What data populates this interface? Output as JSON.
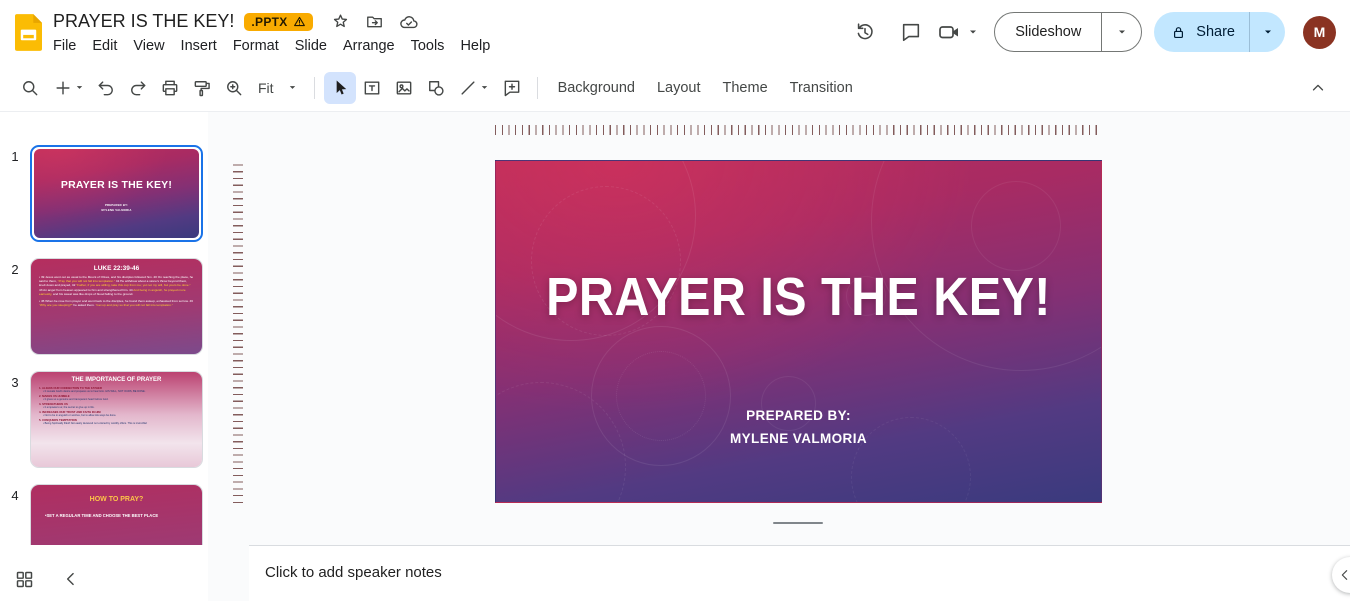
{
  "header": {
    "doc_title": "PRAYER IS THE KEY!",
    "file_badge": ".PPTX",
    "menus": [
      "File",
      "Edit",
      "View",
      "Insert",
      "Format",
      "Slide",
      "Arrange",
      "Tools",
      "Help"
    ],
    "slideshow_label": "Slideshow",
    "share_label": "Share",
    "avatar_initial": "M"
  },
  "toolbar": {
    "zoom_fit_label": "Fit",
    "background_label": "Background",
    "layout_label": "Layout",
    "theme_label": "Theme",
    "transition_label": "Transition"
  },
  "filmstrip": {
    "slides": [
      {
        "number": "1",
        "title": "PRAYER IS THE KEY!",
        "sub1": "PREPARED BY:",
        "sub2": "MYLENE VALMORIA"
      },
      {
        "number": "2",
        "title": "LUKE 22:39-46",
        "body1": [
          {
            "t": "• 39 Jesus went out as usual to the Mount of Olives, and his disciples followed him. 40 On reaching the place, he said to them, ",
            "hl": false
          },
          {
            "t": "“Pray that you will not fall into temptation.”",
            "hl": true
          },
          {
            "t": " 41 He withdrew about a stone’s throw beyond them, knelt down and prayed, 42 ",
            "hl": false
          },
          {
            "t": "“Father, if you are willing, take this cup from me; yet not my will, but yours be done.”",
            "hl": true
          },
          {
            "t": " 43 An angel from heaven appeared to him and strengthened him. 44 ",
            "hl": false
          },
          {
            "t": "And being in anguish, he prayed more earnestly,",
            "hl": true
          },
          {
            "t": " and his sweat was like drops of blood falling to the ground.",
            "hl": false
          }
        ],
        "body2": [
          {
            "t": "• 45 When he rose from prayer and went back to the disciples, he found them asleep, exhausted from sorrow. 46 ",
            "hl": false
          },
          {
            "t": "“Why are you sleeping?”",
            "hl": true
          },
          {
            "t": " he asked them. ",
            "hl": false
          },
          {
            "t": "“Get up and pray so that you will not fall into temptation.”",
            "hl": true
          }
        ]
      },
      {
        "number": "3",
        "title": "THE IMPORTANCE OF PRAYER",
        "lines": [
          {
            "t": "1. ALIGNS OUR CONNECTION TO THE FATHER",
            "c": "red"
          },
          {
            "t": "• It reveals God’s desire and prepares us to hear Him. HIS WILL, NOT OURS, BE DONE.",
            "c": "blue"
          },
          {
            "t": "2. MAKES US HUMBLE",
            "c": "red"
          },
          {
            "t": "• It gives us a genuine and transparent heart before God.",
            "c": "blue"
          },
          {
            "t": "3. STRENGTHENS US",
            "c": "red"
          },
          {
            "t": "• It empowers us; the secret to give up in life.",
            "c": "blue"
          },
          {
            "t": "4. INCREASES OUR TRUST AND FAITH IN HIM",
            "c": "red"
          },
          {
            "t": "• Not to be in anguish or worries, but to allow His ways be done.",
            "c": "blue"
          },
          {
            "t": "5. CONQUERS TEMPTATION",
            "c": "red"
          },
          {
            "t": "• Being Spiritually filled! Not easily deceived nor enticed by worldly offers. This is invincible!",
            "c": "blue"
          }
        ]
      },
      {
        "number": "4",
        "title": "HOW TO PRAY?",
        "body": "•SET A REGULAR TIME AND CHOOSE THE BEST PLACE"
      }
    ]
  },
  "slide": {
    "title": "PRAYER IS THE KEY!",
    "sub1": "PREPARED BY:",
    "sub2": "MYLENE VALMORIA"
  },
  "notes": {
    "placeholder": "Click to add speaker notes"
  },
  "colors": {
    "accent_blue": "#1a73e8",
    "share_pill": "#c2e7ff",
    "badge_orange": "#f9ab00",
    "avatar": "#8a3322",
    "slide_gradient_top": "#b92d5c",
    "slide_gradient_bottom": "#3a3a7e"
  }
}
